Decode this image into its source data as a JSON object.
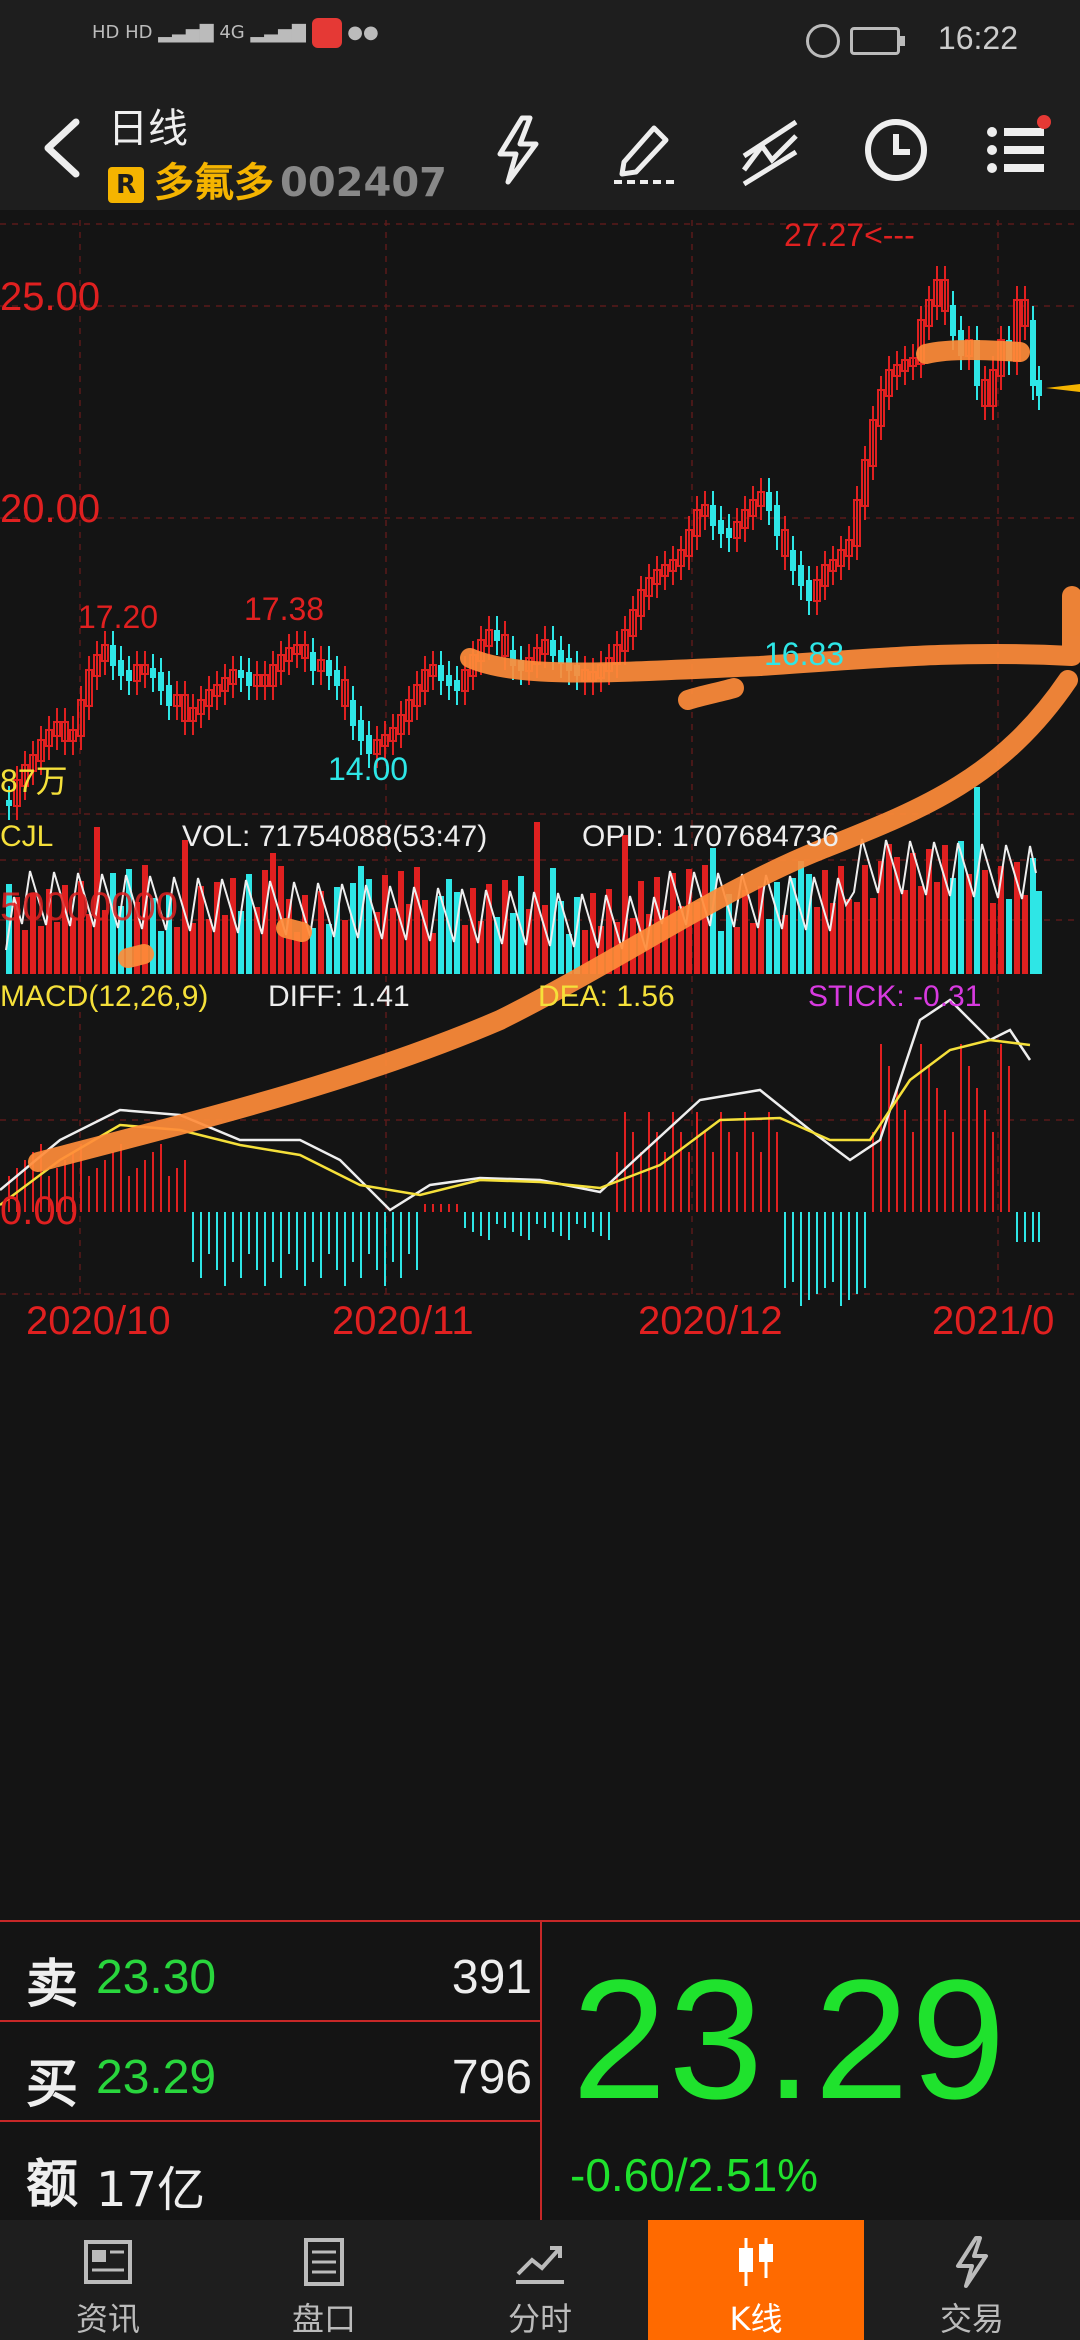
{
  "status_bar": {
    "time": "16:22",
    "signal_label": "4G"
  },
  "header": {
    "period": "日线",
    "badge": "R",
    "stock_name": "多氟多",
    "stock_code": "002407",
    "icons": [
      "lightning-icon",
      "pen-icon",
      "drawing-tool-icon",
      "clock-icon",
      "menu-icon"
    ]
  },
  "chart_data": {
    "type": "candlestick",
    "price_axis": {
      "labels": [
        "25.00",
        "20.00"
      ]
    },
    "annotations": [
      "27.27<---",
      "17.20",
      "17.38",
      "14.00",
      "16.83",
      "87万"
    ],
    "indicators": {
      "vol": {
        "name": "CJL",
        "vol_text": "VOL: 71754088(53:47)",
        "opid_text": "OPID: 1707684736",
        "axis_label": "50000000"
      },
      "macd": {
        "name": "MACD(12,26,9)",
        "diff": "DIFF: 1.41",
        "dea": "DEA: 1.56",
        "stick": "STICK: -0.31",
        "zero_label": "0.00"
      }
    },
    "x_labels": [
      "2020/10",
      "2020/11",
      "2020/12",
      "2021/0"
    ]
  },
  "quote": {
    "sell_label": "卖",
    "sell_price": "23.30",
    "sell_qty": "391",
    "buy_label": "买",
    "buy_price": "23.29",
    "buy_qty": "796",
    "amount_label": "额",
    "amount": "17亿",
    "last_price": "23.29",
    "change": "-0.60/2.51%"
  },
  "colors": {
    "up": "#e02020",
    "down": "#2ee6e6",
    "accent": "#ff6a00",
    "last_price": "#1fe22d"
  },
  "nav": [
    {
      "label": "资讯",
      "icon": "news-icon"
    },
    {
      "label": "盘口",
      "icon": "orderbook-icon"
    },
    {
      "label": "分时",
      "icon": "intraday-icon"
    },
    {
      "label": "K线",
      "icon": "kline-icon",
      "active": true
    },
    {
      "label": "交易",
      "icon": "trade-icon"
    }
  ]
}
